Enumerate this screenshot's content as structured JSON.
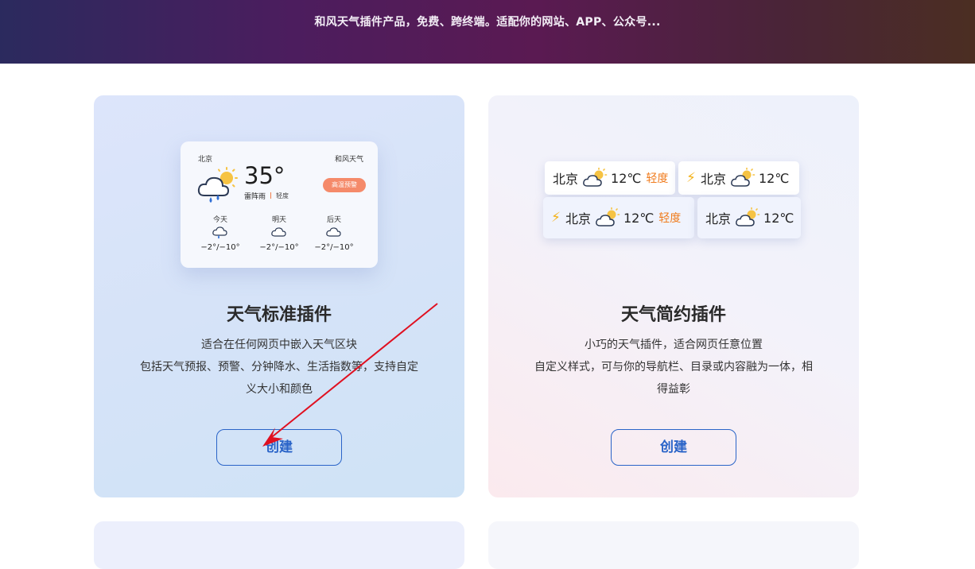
{
  "banner": {
    "text": "和风天气插件产品，免费、跨终端。适配你的网站、APP、公众号..."
  },
  "cards": [
    {
      "title": "天气标准插件",
      "desc_lines": [
        "适合在任何网页中嵌入天气区块",
        "包括天气预报、预警、分钟降水、生活指数等，支持自定",
        "义大小和颜色"
      ],
      "button": "创建",
      "preview": {
        "city": "北京",
        "brand": "和风天气",
        "temp": "35°",
        "condition": "雷阵雨",
        "level": "轻度",
        "alert": "高温预警",
        "days": [
          {
            "label": "今天",
            "range": "−2°/−10°",
            "icon": "rain-cloud-icon"
          },
          {
            "label": "明天",
            "range": "−2°/−10°",
            "icon": "cloud-icon"
          },
          {
            "label": "后天",
            "range": "−2°/−10°",
            "icon": "cloud-icon"
          }
        ]
      }
    },
    {
      "title": "天气简约插件",
      "desc_lines": [
        "小巧的天气插件，适合网页任意位置",
        "自定义样式，可与你的导航栏、目录或内容融为一体，相",
        "得益彰"
      ],
      "button": "创建",
      "preview": {
        "pills": [
          {
            "city": "北京",
            "temp": "12℃",
            "level": "轻度",
            "bolt": false
          },
          {
            "city": "北京",
            "temp": "12℃",
            "level": "",
            "bolt": true
          },
          {
            "city": "北京",
            "temp": "12℃",
            "level": "轻度",
            "bolt": true
          },
          {
            "city": "北京",
            "temp": "12℃",
            "level": "",
            "bolt": false
          }
        ]
      }
    }
  ],
  "colors": {
    "accent": "#2a64c8",
    "alert": "#f58a6a",
    "arrow": "#e01020",
    "level": "#f07c1e"
  }
}
